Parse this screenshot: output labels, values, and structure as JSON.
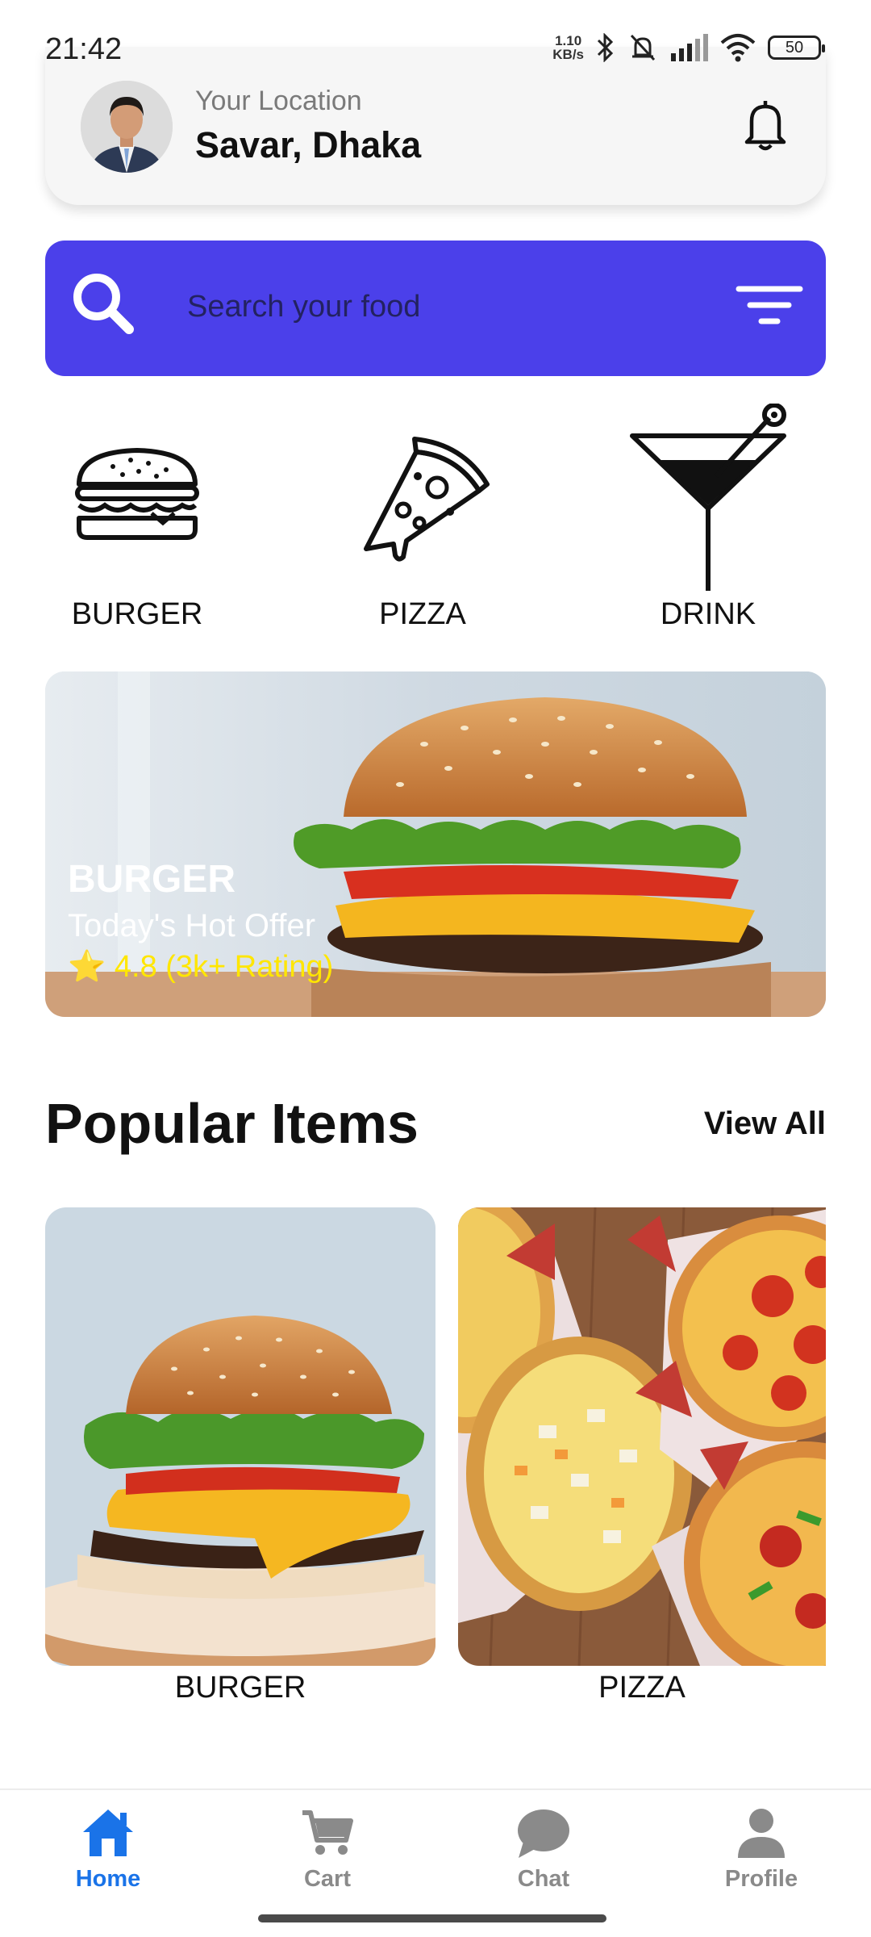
{
  "status_bar": {
    "time": "21:42",
    "net_speed_value": "1.10",
    "net_speed_unit": "KB/s",
    "battery": "50",
    "icons": [
      "bluetooth-icon",
      "bell-muted-icon",
      "signal-icon",
      "wifi-icon",
      "battery-icon"
    ]
  },
  "header": {
    "location_label": "Your Location",
    "location_value": "Savar, Dhaka",
    "avatar": "avatar",
    "notification_icon": "bell-icon"
  },
  "search": {
    "placeholder": "Search your food",
    "icon": "search-icon",
    "filter_icon": "filter-icon",
    "color": "#4b40ea"
  },
  "categories": [
    {
      "label": "BURGER",
      "icon": "burger-icon"
    },
    {
      "label": "PIZZA",
      "icon": "pizza-slice-icon"
    },
    {
      "label": "DRINK",
      "icon": "cocktail-icon"
    }
  ],
  "banner": {
    "title": "BURGER",
    "subtitle": "Today's Hot Offer",
    "rating": "⭐ 4.8 (3k+ Rating)"
  },
  "popular": {
    "title": "Popular Items",
    "view_all": "View All",
    "items": [
      {
        "label": "BURGER"
      },
      {
        "label": "PIZZA"
      }
    ]
  },
  "bottom_nav": {
    "active_color": "#1a73e8",
    "inactive_color": "#8a8a8a",
    "items": [
      {
        "label": "Home",
        "icon": "home-icon",
        "active": true
      },
      {
        "label": "Cart",
        "icon": "cart-icon",
        "active": false
      },
      {
        "label": "Chat",
        "icon": "chat-icon",
        "active": false
      },
      {
        "label": "Profile",
        "icon": "profile-icon",
        "active": false
      }
    ]
  }
}
